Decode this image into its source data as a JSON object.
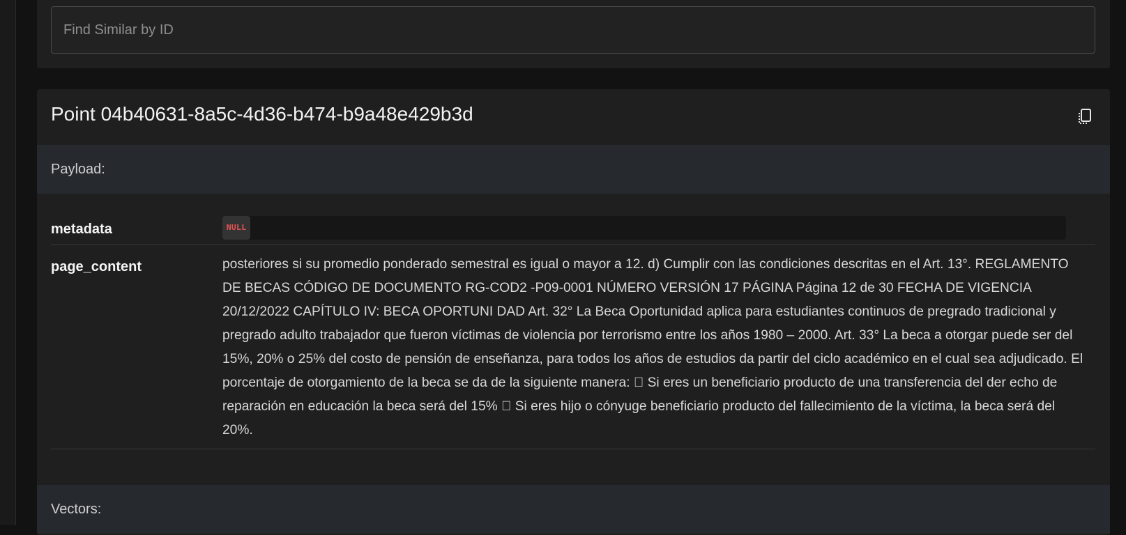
{
  "search": {
    "placeholder": "Find Similar by ID"
  },
  "point": {
    "title": "Point 04b40631-8a5c-4d36-b474-b9a48e429b3d",
    "copy_icon": "copy-icon"
  },
  "payload": {
    "label": "Payload:",
    "fields": [
      {
        "key": "metadata",
        "value": "NULL"
      },
      {
        "key": "page_content",
        "value": "posteriores si su promedio ponderado semestral es igual o mayor a 12. d) Cumplir con las condiciones descritas en el Art. 13°. REGLAMENTO DE BECAS CÓDIGO DE DOCUMENTO RG-COD2 -P09-0001 NÚMERO VERSIÓN 17 PÁGINA Página 12 de 30 FECHA DE VIGENCIA 20/12/2022 CAPÍTULO IV: BECA OPORTUNI DAD Art. 32° La Beca Oportunidad aplica para estudiantes continuos de pregrado tradicional y pregrado adulto trabajador que fueron víctimas de violencia por terrorismo entre los años 1980 – 2000. Art. 33° La beca a otorgar puede ser del 15%, 20% o 25% del costo de pensión de enseñanza, para todos los años de estudios da partir del ciclo académico en el cual sea adjudicado. El porcentaje de otorgamiento de la beca se da de la siguiente manera:  Si eres un beneficiario producto de una transferencia del der echo de reparación en educación la beca será del 15%  Si eres hijo o cónyuge beneficiario producto del fallecimiento de la víctima, la beca será del 20%."
      }
    ]
  },
  "vectors": {
    "label": "Vectors:"
  },
  "colors": {
    "background": "#121212",
    "panel": "#1f1f1f",
    "section_bar": "#262a2f",
    "null_text": "#e05252"
  }
}
